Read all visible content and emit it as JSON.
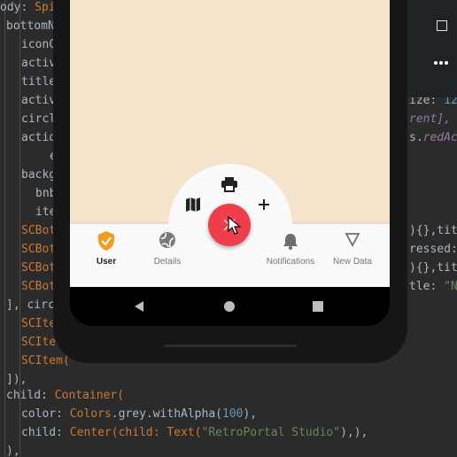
{
  "code_lines": [
    [
      "ody: ",
      "Spi"
    ],
    [
      "bottomN"
    ],
    [
      "iconC"
    ],
    [
      "activ"
    ],
    [
      "title"
    ],
    [
      "activ"
    ],
    [
      "circl"
    ],
    [
      "actio"
    ],
    [
      "e"
    ],
    [
      "backg"
    ],
    [
      "bnb"
    ],
    [
      "ite"
    ],
    [
      "SCBot"
    ],
    [
      "SCBot"
    ],
    [
      "SCBot"
    ],
    [
      "SCBot"
    ],
    [
      "], circ"
    ],
    [
      "SCIte"
    ],
    [
      "SCIte"
    ],
    [
      "SCItem("
    ],
    [
      "]),"
    ]
  ],
  "code_right": [
    ".2",
    "ize: 12,",
    "rent],",
    "s.redAc",
    "){},tit",
    "ressed:",
    "){},tit",
    "tle: \"N"
  ],
  "code_bottom": [
    {
      "a": "child: ",
      "b": "Container("
    },
    {
      "a": "color: ",
      "b": "Colors",
      "c": ".grey.withAlpha(",
      "n": "100",
      "d": "),"
    },
    {
      "a": "child: ",
      "b": "Center(child: Text(",
      "s": "\"RetroPortal Studio\"",
      "d": "),),"
    },
    {
      "a": "),"
    }
  ],
  "nav": {
    "items": [
      {
        "label": "User",
        "icon": "shield-check-icon",
        "active": true
      },
      {
        "label": "Details",
        "icon": "sports-ball-icon",
        "active": false
      },
      {
        "label": "Notifications",
        "icon": "bell-icon",
        "active": false
      },
      {
        "label": "New Data",
        "icon": "triangle-icon",
        "active": false
      }
    ],
    "fab_icon": "close-icon",
    "circular_menu": [
      "print-icon",
      "map-icon",
      "add-icon"
    ]
  },
  "colors": {
    "screen_bg": "#f6e3cc",
    "accent": "#f59c1a",
    "fab": "#f03d4b",
    "inactive": "#757575"
  }
}
